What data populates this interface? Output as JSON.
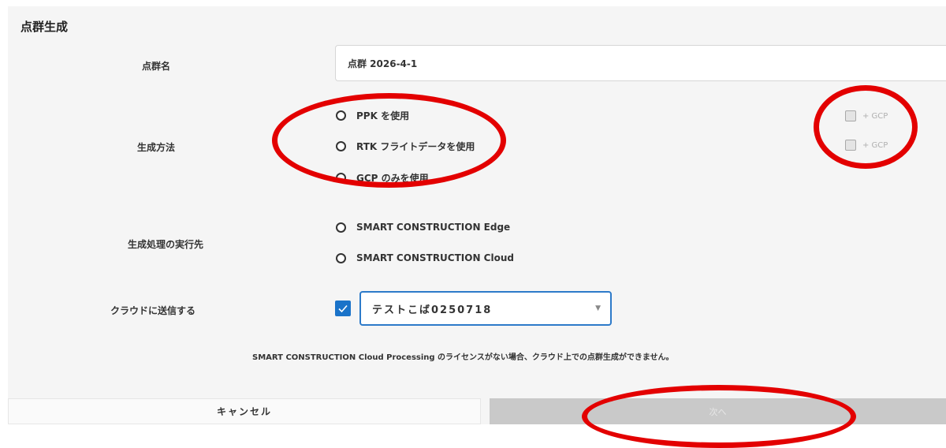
{
  "dialog": {
    "title": "点群生成"
  },
  "point_cloud_name": {
    "label": "点群名",
    "value": "点群 2026-4-1"
  },
  "generation_method": {
    "label": "生成方法",
    "options": [
      {
        "label": "PPK を使用",
        "gcp_label": "+ GCP"
      },
      {
        "label": "RTK フライトデータを使用",
        "gcp_label": "+ GCP"
      },
      {
        "label": "GCP のみを使用"
      }
    ]
  },
  "execution_target": {
    "label": "生成処理の実行先",
    "options": [
      {
        "label": "SMART CONSTRUCTION Edge"
      },
      {
        "label": "SMART CONSTRUCTION Cloud"
      }
    ]
  },
  "send_to_cloud": {
    "label": "クラウドに送信する",
    "checked": true,
    "selected_project": "テストこば0250718"
  },
  "license_note": "SMART CONSTRUCTION Cloud Processing のライセンスがない場合、クラウド上での点群生成ができません。",
  "footer": {
    "cancel_label": "キャンセル",
    "next_label": "次へ"
  },
  "colors": {
    "accent": "#1a73c9",
    "annotation": "#e30000",
    "disabled_button": "#c9c9c9"
  }
}
